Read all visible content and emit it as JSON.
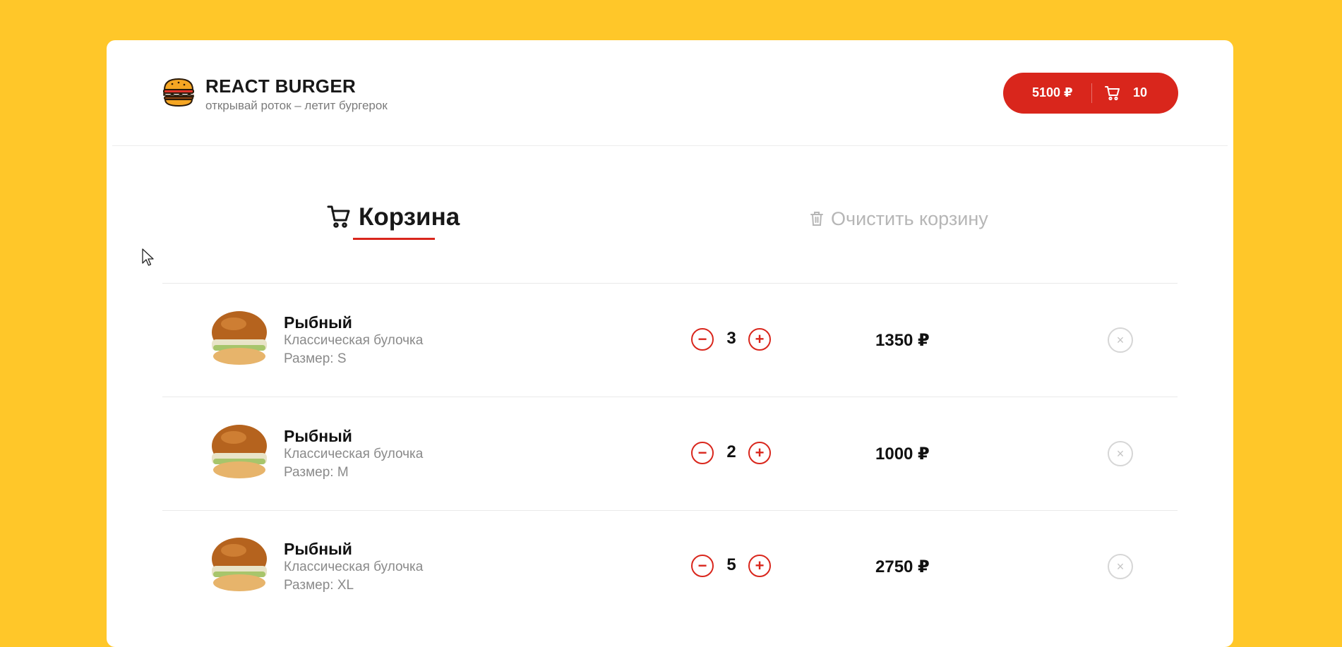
{
  "header": {
    "brand_title": "REACT BURGER",
    "brand_subtitle": "открывай роток – летит бургерок",
    "cart_total": "5100 ₽",
    "cart_count": "10",
    "logo_icon": "burger-icon",
    "cart_icon": "cart-icon"
  },
  "cart": {
    "title": "Корзина",
    "clear_label": "Очистить корзину",
    "title_icon": "cart-icon",
    "clear_icon": "trash-icon",
    "items": [
      {
        "name": "Рыбный",
        "bun": "Классическая булочка",
        "size": "Размер: S",
        "qty": "3",
        "price": "1350 ₽"
      },
      {
        "name": "Рыбный",
        "bun": "Классическая булочка",
        "size": "Размер: M",
        "qty": "2",
        "price": "1000 ₽"
      },
      {
        "name": "Рыбный",
        "bun": "Классическая булочка",
        "size": "Размер: XL",
        "qty": "5",
        "price": "2750 ₽"
      }
    ]
  },
  "controls": {
    "minus": "−",
    "plus": "+",
    "remove": "×"
  },
  "colors": {
    "background": "#FFC729",
    "accent": "#D9261C",
    "card": "#FFFFFF"
  }
}
